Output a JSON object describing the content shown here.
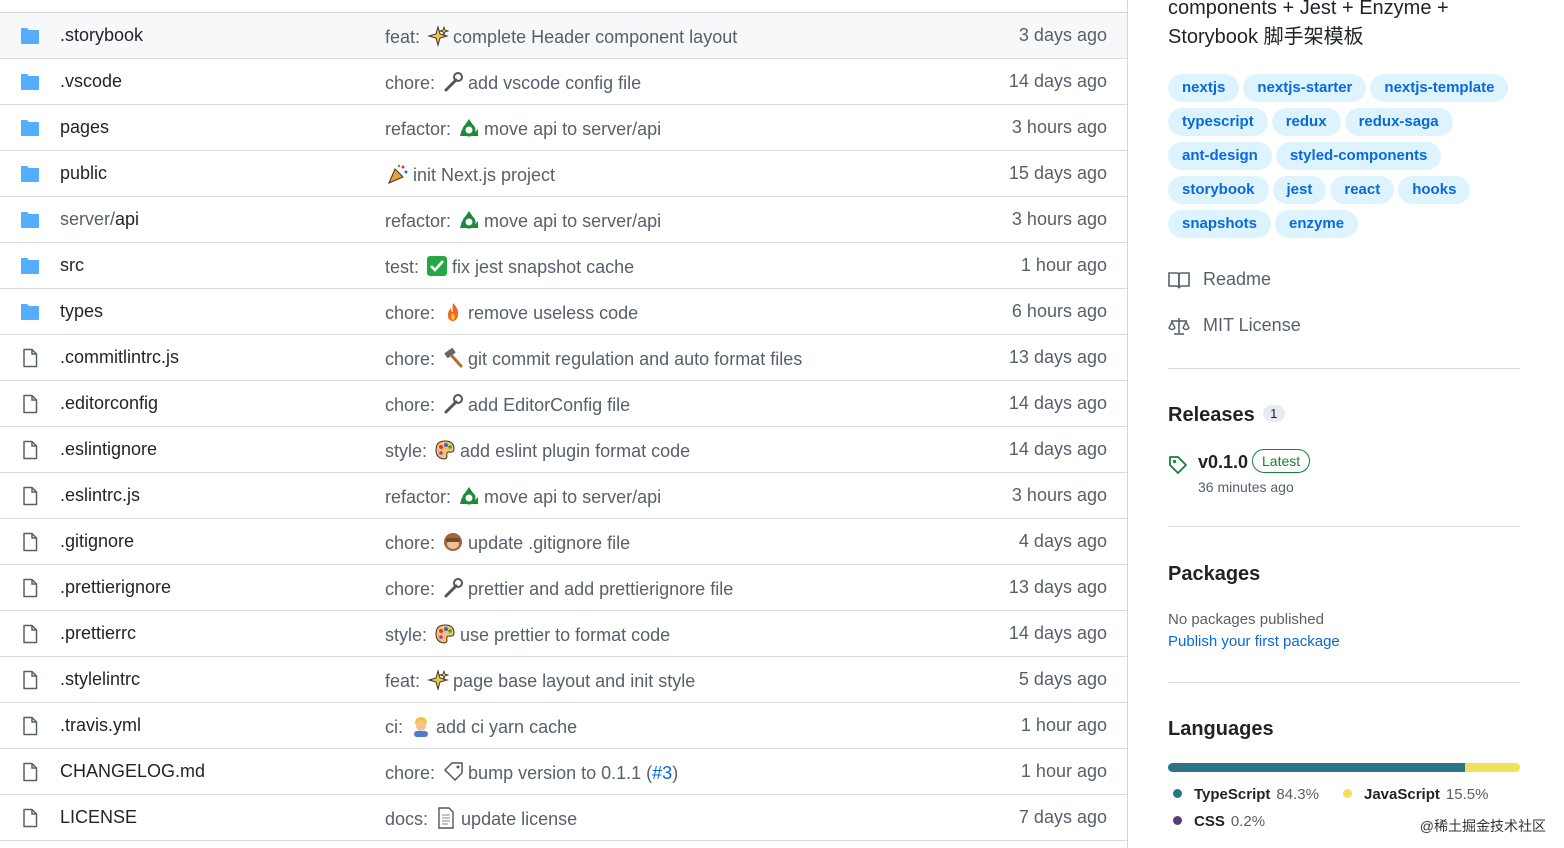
{
  "file_list": {
    "rows": [
      {
        "type": "folder",
        "name": ".storybook",
        "name_prefix": "",
        "commit_type": "feat:",
        "emoji": "sparkles",
        "message": "complete Header component layout",
        "link": "",
        "suffix": "",
        "age": "3 days ago"
      },
      {
        "type": "folder",
        "name": ".vscode",
        "name_prefix": "",
        "commit_type": "chore:",
        "emoji": "wrench",
        "message": "add vscode config file",
        "link": "",
        "suffix": "",
        "age": "14 days ago"
      },
      {
        "type": "folder",
        "name": "pages",
        "name_prefix": "",
        "commit_type": "refactor:",
        "emoji": "recycle",
        "message": "move api to server/api",
        "link": "",
        "suffix": "",
        "age": "3 hours ago"
      },
      {
        "type": "folder",
        "name": "public",
        "name_prefix": "",
        "commit_type": "",
        "emoji": "tada",
        "message": "init Next.js project",
        "link": "",
        "suffix": "",
        "age": "15 days ago"
      },
      {
        "type": "folder",
        "name": "api",
        "name_prefix": "server/",
        "commit_type": "refactor:",
        "emoji": "recycle",
        "message": "move api to server/api",
        "link": "",
        "suffix": "",
        "age": "3 hours ago"
      },
      {
        "type": "folder",
        "name": "src",
        "name_prefix": "",
        "commit_type": "test:",
        "emoji": "check",
        "message": "fix jest snapshot cache",
        "link": "",
        "suffix": "",
        "age": "1 hour ago"
      },
      {
        "type": "folder",
        "name": "types",
        "name_prefix": "",
        "commit_type": "chore:",
        "emoji": "fire",
        "message": "remove useless code",
        "link": "",
        "suffix": "",
        "age": "6 hours ago"
      },
      {
        "type": "file",
        "name": ".commitlintrc.js",
        "name_prefix": "",
        "commit_type": "chore:",
        "emoji": "hammer",
        "message": "git commit regulation and auto format files",
        "link": "",
        "suffix": "",
        "age": "13 days ago"
      },
      {
        "type": "file",
        "name": ".editorconfig",
        "name_prefix": "",
        "commit_type": "chore:",
        "emoji": "wrench",
        "message": "add EditorConfig file",
        "link": "",
        "suffix": "",
        "age": "14 days ago"
      },
      {
        "type": "file",
        "name": ".eslintignore",
        "name_prefix": "",
        "commit_type": "style:",
        "emoji": "palette",
        "message": "add eslint plugin format code",
        "link": "",
        "suffix": "",
        "age": "14 days ago"
      },
      {
        "type": "file",
        "name": ".eslintrc.js",
        "name_prefix": "",
        "commit_type": "refactor:",
        "emoji": "recycle",
        "message": "move api to server/api",
        "link": "",
        "suffix": "",
        "age": "3 hours ago"
      },
      {
        "type": "file",
        "name": ".gitignore",
        "name_prefix": "",
        "commit_type": "chore:",
        "emoji": "monkey",
        "message": "update .gitignore file",
        "link": "",
        "suffix": "",
        "age": "4 days ago"
      },
      {
        "type": "file",
        "name": ".prettierignore",
        "name_prefix": "",
        "commit_type": "chore:",
        "emoji": "wrench",
        "message": "prettier and add prettierignore file",
        "link": "",
        "suffix": "",
        "age": "13 days ago"
      },
      {
        "type": "file",
        "name": ".prettierrc",
        "name_prefix": "",
        "commit_type": "style:",
        "emoji": "palette",
        "message": "use prettier to format code",
        "link": "",
        "suffix": "",
        "age": "14 days ago"
      },
      {
        "type": "file",
        "name": ".stylelintrc",
        "name_prefix": "",
        "commit_type": "feat:",
        "emoji": "sparkles",
        "message": "page base layout and init style",
        "link": "",
        "suffix": "",
        "age": "5 days ago"
      },
      {
        "type": "file",
        "name": ".travis.yml",
        "name_prefix": "",
        "commit_type": "ci:",
        "emoji": "worker",
        "message": "add ci yarn cache",
        "link": "",
        "suffix": "",
        "age": "1 hour ago"
      },
      {
        "type": "file",
        "name": "CHANGELOG.md",
        "name_prefix": "",
        "commit_type": "chore:",
        "emoji": "bookmark",
        "message": "bump version to 0.1.1 (",
        "link": "#3",
        "suffix": ")",
        "age": "1 hour ago"
      },
      {
        "type": "file",
        "name": "LICENSE",
        "name_prefix": "",
        "commit_type": "docs:",
        "emoji": "page",
        "message": "update license",
        "link": "",
        "suffix": "",
        "age": "7 days ago"
      }
    ]
  },
  "sidebar": {
    "about_line1": "components + Jest + Enzyme +",
    "about_line2": "Storybook 脚手架模板",
    "topics": [
      "nextjs",
      "nextjs-starter",
      "nextjs-template",
      "typescript",
      "redux",
      "redux-saga",
      "ant-design",
      "styled-components",
      "storybook",
      "jest",
      "react",
      "hooks",
      "snapshots",
      "enzyme"
    ],
    "readme_label": "Readme",
    "license_label": "MIT License",
    "releases": {
      "heading": "Releases",
      "count": "1",
      "version": "v0.1.0",
      "badge": "Latest",
      "time": "36 minutes ago"
    },
    "packages": {
      "heading": "Packages",
      "empty_text": "No packages published",
      "link": "Publish your first package"
    },
    "languages": {
      "heading": "Languages",
      "items": [
        {
          "name": "TypeScript",
          "percent": "84.3%",
          "value": 84.3,
          "color": "#2b7489"
        },
        {
          "name": "JavaScript",
          "percent": "15.5%",
          "value": 15.5,
          "color": "#f1e05a"
        },
        {
          "name": "CSS",
          "percent": "0.2%",
          "value": 0.2,
          "color": "#563d7c"
        }
      ]
    },
    "watermark": "@稀土掘金技术社区"
  }
}
